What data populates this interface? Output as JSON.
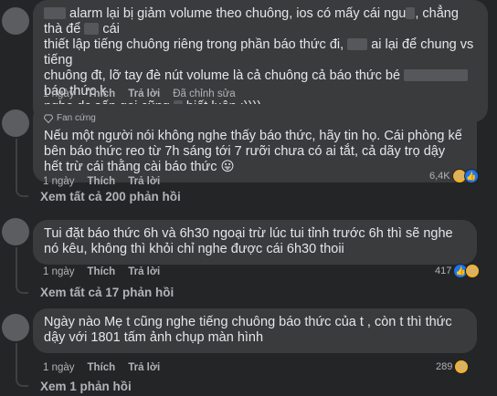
{
  "comments": [
    {
      "text_parts": {
        "p1": "alarm lại bị giảm volume theo chuông, ios có mấy cái ngu",
        "p2": ", chẳng thà để",
        "p3": "cái",
        "p4": "thiết lập tiếng chuông riêng trong phần báo thức đi,",
        "p5": "ai lại để chung vs tiếng",
        "p6": "chuông đt, lỡ tay đè nút volume là cả chuông cả báo thức bé",
        "p7": "báo thức k",
        "p8": "nghe dc sếp gọi cũng",
        "p9": "biết luôn :))))"
      },
      "time": "1 ngày",
      "like": "Thích",
      "reply": "Trả lời",
      "edited": "Đã chỉnh sửa"
    },
    {
      "badge": "Fan cứng",
      "text": "Nếu một người nói không nghe thấy báo thức, hãy tin họ. Cái phòng kế bên báo thức reo từ 7h sáng tới 7 rưỡi chưa có ai tắt, cả dãy trọ dậy hết trừ cái thằng cài báo thức 😛",
      "time": "1 ngày",
      "like": "Thích",
      "reply": "Trả lời",
      "reactions": "6,4K",
      "view_replies": "Xem tất cả 200 phản hồi"
    },
    {
      "text": "Tui đặt báo thức 6h và 6h30 ngoại trừ lúc tui tỉnh trước 6h thì sẽ nghe nó kêu, không thì khỏi chỉ nghe được cái 6h30 thoii",
      "time": "1 ngày",
      "like": "Thích",
      "reply": "Trả lời",
      "reactions": "417",
      "view_replies": "Xem tất cả 17 phản hồi"
    },
    {
      "text": "Ngày nào Mẹ t cũng nghe tiếng chuông báo thức của t , còn t thì thức dậy với 1801 tấm ảnh chụp màn hình",
      "time": "1 ngày",
      "like": "Thích",
      "reply": "Trả lời",
      "reactions": "289",
      "view_replies": "Xem 1 phản hồi"
    }
  ],
  "colors": {
    "background": "#242526",
    "bubble": "#3a3b3c",
    "text": "#e4e6eb",
    "muted": "#b0b3b8"
  },
  "icons": {
    "badge": "diamond-icon",
    "haha": "haha-reaction-icon",
    "like": "like-reaction-icon"
  }
}
